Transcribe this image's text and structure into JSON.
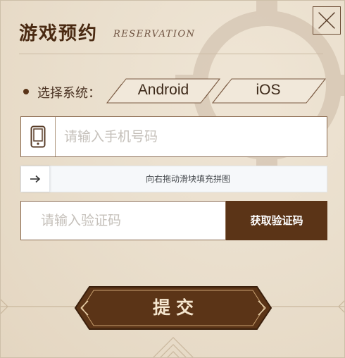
{
  "dialog": {
    "title": "游戏预约",
    "subtitle": "RESERVATION",
    "close_icon": "close-icon"
  },
  "system": {
    "label": "选择系统：",
    "options": [
      {
        "label": "Android"
      },
      {
        "label": "iOS"
      }
    ]
  },
  "phone": {
    "placeholder": "请输入手机号码",
    "value": "",
    "icon": "phone-icon"
  },
  "slider": {
    "hint": "向右拖动滑块填充拼图",
    "icon": "arrow-right-icon"
  },
  "verify": {
    "placeholder": "请输入验证码",
    "value": "",
    "button_label": "获取验证码"
  },
  "submit": {
    "label": "提交"
  },
  "colors": {
    "brand_brown": "#5b3417",
    "background": "#eadfcd",
    "text_dark": "#4a2a12"
  }
}
